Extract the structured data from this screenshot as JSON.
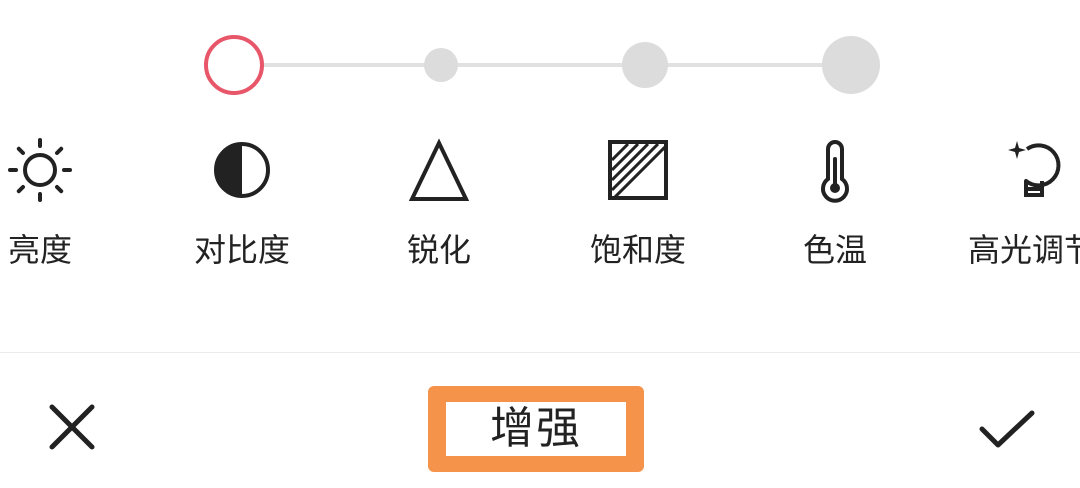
{
  "slider": {
    "stops": [
      "stop-1",
      "stop-2",
      "stop-3",
      "stop-4"
    ],
    "selected_index": 0,
    "colors": {
      "selected_ring": "#e8566a",
      "stop_fill": "#dcdcdc",
      "track": "#e1e1e1"
    }
  },
  "tools": [
    {
      "label": "亮度",
      "icon": "sun-brightness-icon"
    },
    {
      "label": "对比度",
      "icon": "half-circle-contrast-icon"
    },
    {
      "label": "锐化",
      "icon": "triangle-sharpen-icon"
    },
    {
      "label": "饱和度",
      "icon": "hatched-square-saturation-icon"
    },
    {
      "label": "色温",
      "icon": "thermometer-icon"
    },
    {
      "label": "高光调节",
      "icon": "lightbulb-sparkle-icon"
    }
  ],
  "bottom_bar": {
    "cancel_icon": "close-icon",
    "confirm_icon": "checkmark-icon",
    "title": "增强",
    "highlight_color": "#f5934a"
  }
}
